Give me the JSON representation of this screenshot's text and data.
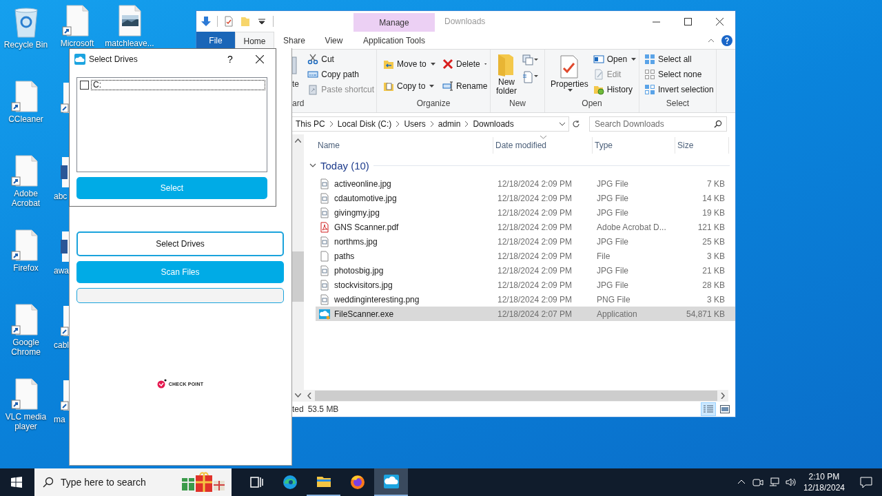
{
  "desktop": {
    "column_1": [
      {
        "label": "Recycle Bin",
        "kind": "recycle"
      },
      {
        "label": "CCleaner",
        "kind": "shortcut"
      },
      {
        "label": "Adobe Acrobat",
        "kind": "shortcut"
      },
      {
        "label": "Firefox",
        "kind": "shortcut"
      },
      {
        "label": "Google Chrome",
        "kind": "shortcut"
      },
      {
        "label": "VLC media player",
        "kind": "shortcut"
      }
    ],
    "column_2": [
      {
        "label": "Microsoft",
        "kind": "shortcut"
      },
      {
        "kind": "shortcut"
      },
      {
        "label": "abc",
        "kind": "word"
      },
      {
        "label": "awa",
        "kind": "word"
      },
      {
        "label": "cabl",
        "kind": "shortcut"
      },
      {
        "label": "ma",
        "kind": "shortcut"
      }
    ],
    "column_3": [
      {
        "label": "matchleave...",
        "kind": "image"
      }
    ]
  },
  "explorer": {
    "title": "Downloads",
    "context_group": "Manage",
    "tabs": [
      {
        "label": "File",
        "selected": false
      },
      {
        "label": "Home",
        "selected": true
      },
      {
        "label": "Share",
        "selected": false
      },
      {
        "label": "View",
        "selected": false
      },
      {
        "label": "Application Tools",
        "selected": false
      }
    ],
    "clipboard": {
      "label": "ard",
      "paste_fragment": "te",
      "items": [
        {
          "label": "Cut",
          "kind": "cut",
          "disabled": false
        },
        {
          "label": "Copy path",
          "kind": "copy-path",
          "disabled": false
        },
        {
          "label": "Paste shortcut",
          "kind": "paste-shortcut",
          "disabled": true
        }
      ]
    },
    "organize": {
      "label": "Organize",
      "items": [
        {
          "label": "Move to",
          "kind": "move"
        },
        {
          "label": "Delete",
          "kind": "delete"
        },
        {
          "label": "Copy to",
          "kind": "copy"
        },
        {
          "label": "Rename",
          "kind": "rename"
        }
      ]
    },
    "new": {
      "label": "New",
      "new_folder": "New folder"
    },
    "open": {
      "label": "Open",
      "properties": "Properties",
      "items": [
        {
          "label": "Open",
          "kind": "open",
          "disabled": false
        },
        {
          "label": "Edit",
          "kind": "edit",
          "disabled": true
        },
        {
          "label": "History",
          "kind": "history",
          "disabled": false
        }
      ]
    },
    "select": {
      "label": "Select",
      "items": [
        {
          "label": "Select all",
          "kind": "all"
        },
        {
          "label": "Select none",
          "kind": "none"
        },
        {
          "label": "Invert selection",
          "kind": "invert"
        }
      ]
    },
    "address": [
      "This PC",
      "Local Disk (C:)",
      "Users",
      "admin",
      "Downloads"
    ],
    "search": {
      "placeholder": "Search Downloads"
    },
    "columns": [
      "Name",
      "Date modified",
      "Type",
      "Size"
    ],
    "group": {
      "label": "Today (10)",
      "expanded": true
    },
    "files": [
      {
        "name": "activeonline.jpg",
        "date": "12/18/2024 2:09 PM",
        "type": "JPG File",
        "size": "7 KB",
        "kind": "image",
        "selected": false
      },
      {
        "name": "cdautomotive.jpg",
        "date": "12/18/2024 2:09 PM",
        "type": "JPG File",
        "size": "14 KB",
        "kind": "image",
        "selected": false
      },
      {
        "name": "givingmy.jpg",
        "date": "12/18/2024 2:09 PM",
        "type": "JPG File",
        "size": "19 KB",
        "kind": "image",
        "selected": false
      },
      {
        "name": "GNS Scanner.pdf",
        "date": "12/18/2024 2:09 PM",
        "type": "Adobe Acrobat D...",
        "size": "121 KB",
        "kind": "pdf",
        "selected": false
      },
      {
        "name": "northms.jpg",
        "date": "12/18/2024 2:09 PM",
        "type": "JPG File",
        "size": "25 KB",
        "kind": "image",
        "selected": false
      },
      {
        "name": "paths",
        "date": "12/18/2024 2:09 PM",
        "type": "File",
        "size": "3 KB",
        "kind": "file",
        "selected": false
      },
      {
        "name": "photosbig.jpg",
        "date": "12/18/2024 2:09 PM",
        "type": "JPG File",
        "size": "21 KB",
        "kind": "image",
        "selected": false
      },
      {
        "name": "stockvisitors.jpg",
        "date": "12/18/2024 2:09 PM",
        "type": "JPG File",
        "size": "28 KB",
        "kind": "image",
        "selected": false
      },
      {
        "name": "weddinginteresting.png",
        "date": "12/18/2024 2:09 PM",
        "type": "PNG File",
        "size": "3 KB",
        "kind": "image",
        "selected": false
      },
      {
        "name": "FileScanner.exe",
        "date": "12/18/2024 2:07 PM",
        "type": "Application",
        "size": "54,871 KB",
        "kind": "app",
        "selected": true
      }
    ],
    "status": {
      "fragment": "ted",
      "size": "53.5 MB"
    },
    "views": [
      {
        "kind": "details",
        "selected": true
      },
      {
        "kind": "large-icons",
        "selected": false
      }
    ]
  },
  "scanner": {
    "buttons": [
      {
        "label": "Select Drives",
        "kind": "outline"
      },
      {
        "label": "Scan Files",
        "kind": "filled"
      }
    ],
    "progress": {
      "level": 0
    },
    "brand": "CHECK POINT",
    "dialog": {
      "title": "Select Drives",
      "help": "?",
      "drives": [
        {
          "label": "C:",
          "checked": false
        }
      ],
      "button": "Select"
    }
  },
  "taskbar": {
    "search": {
      "placeholder": "Type here to search"
    },
    "apps": [
      {
        "kind": "task-view",
        "running": false,
        "selected": false
      },
      {
        "kind": "edge",
        "running": false,
        "selected": false
      },
      {
        "kind": "explorer",
        "running": true,
        "selected": false
      },
      {
        "kind": "firefox",
        "running": false,
        "selected": false
      },
      {
        "kind": "scanner",
        "running": true,
        "selected": true
      }
    ],
    "time": "2:10 PM",
    "date": "12/18/2024"
  }
}
